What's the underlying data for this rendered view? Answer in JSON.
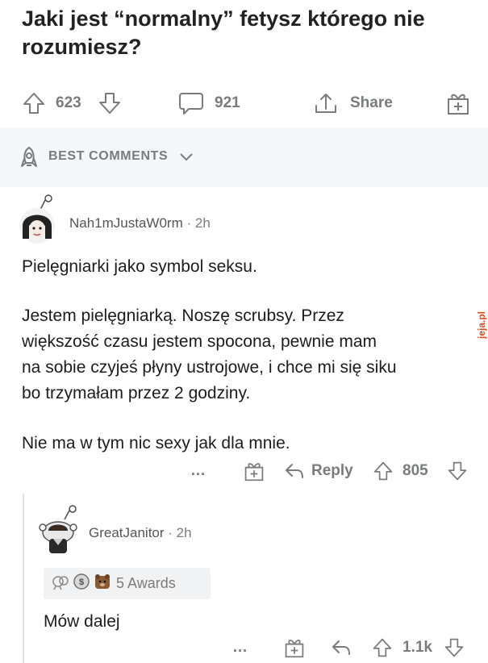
{
  "post": {
    "title": "Jaki jest “normalny” fetysz którego nie rozumiesz?",
    "upvotes": "623",
    "comments_count": "921",
    "share_label": "Share"
  },
  "sort": {
    "label": "BEST COMMENTS"
  },
  "comment1": {
    "username": "Nah1mJustaW0rm",
    "time": "· 2h",
    "lines": [
      "Pielęgniarki jako symbol seksu.",
      "Jestem pielęgniarką. Noszę scrubsy. Przez",
      "większość czasu jestem spocona, pewnie mam",
      "na sobie czyjeś płyny ustrojowe, i chce mi się siku",
      "bo trzymałam przez 2 godziny.",
      "Nie ma w tym nic sexy jak dla mnie."
    ],
    "more_label": "…",
    "reply_label": "Reply",
    "score": "805"
  },
  "comment2": {
    "username": "GreatJanitor",
    "time": "· 2h",
    "awards_label": "5 Awards",
    "text": "Mów dalej",
    "more_label": "…",
    "score": "1.1k"
  },
  "watermark": {
    "text": "jeja.pl"
  },
  "colors": {
    "meta_gray": "#787c7e",
    "text": "#1c1c1c",
    "sort_bg": "#f6f7f8",
    "watermark": "#d94a1e"
  }
}
